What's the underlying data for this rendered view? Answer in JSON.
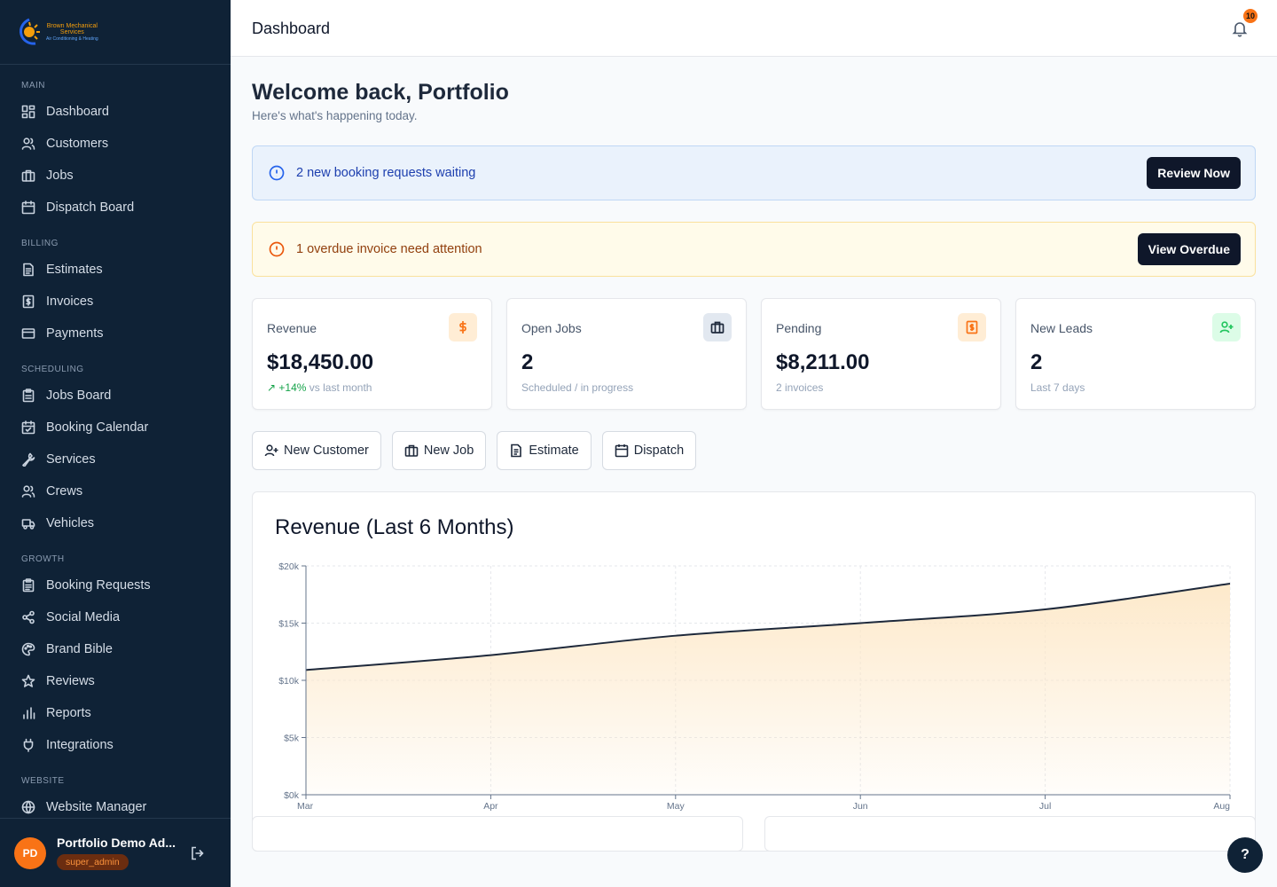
{
  "brand": {
    "line1": "Brown Mechanical",
    "line2": "Services",
    "tagline": "Air Conditioning & Heating"
  },
  "sidebar": {
    "sections": [
      {
        "title": "MAIN",
        "items": [
          {
            "label": "Dashboard",
            "icon": "dashboard-icon"
          },
          {
            "label": "Customers",
            "icon": "users-icon"
          },
          {
            "label": "Jobs",
            "icon": "briefcase-icon"
          },
          {
            "label": "Dispatch Board",
            "icon": "calendar-icon"
          }
        ]
      },
      {
        "title": "BILLING",
        "items": [
          {
            "label": "Estimates",
            "icon": "file-text-icon"
          },
          {
            "label": "Invoices",
            "icon": "receipt-icon"
          },
          {
            "label": "Payments",
            "icon": "credit-card-icon"
          }
        ]
      },
      {
        "title": "SCHEDULING",
        "items": [
          {
            "label": "Jobs Board",
            "icon": "clipboard-icon"
          },
          {
            "label": "Booking Calendar",
            "icon": "calendar-check-icon"
          },
          {
            "label": "Services",
            "icon": "wrench-icon"
          },
          {
            "label": "Crews",
            "icon": "users-icon"
          },
          {
            "label": "Vehicles",
            "icon": "truck-icon"
          }
        ]
      },
      {
        "title": "GROWTH",
        "items": [
          {
            "label": "Booking Requests",
            "icon": "clipboard-list-icon"
          },
          {
            "label": "Social Media",
            "icon": "share-icon"
          },
          {
            "label": "Brand Bible",
            "icon": "palette-icon"
          },
          {
            "label": "Reviews",
            "icon": "star-icon"
          },
          {
            "label": "Reports",
            "icon": "bar-chart-icon"
          },
          {
            "label": "Integrations",
            "icon": "plug-icon"
          }
        ]
      },
      {
        "title": "WEBSITE",
        "items": [
          {
            "label": "Website Manager",
            "icon": "globe-icon"
          }
        ]
      }
    ]
  },
  "user": {
    "initials": "PD",
    "name": "Portfolio Demo Ad...",
    "role": "super_admin"
  },
  "header": {
    "title": "Dashboard",
    "notification_count": "10"
  },
  "welcome": {
    "title": "Welcome back, Portfolio",
    "subtitle": "Here's what's happening today."
  },
  "alerts": {
    "booking": {
      "text": "2 new booking requests waiting",
      "button": "Review Now"
    },
    "overdue": {
      "text": "1 overdue invoice need attention",
      "button": "View Overdue"
    }
  },
  "stats": [
    {
      "label": "Revenue",
      "value": "$18,450.00",
      "trend": "+14%",
      "sub": "vs last month",
      "icon": "dollar-icon",
      "accent": "#f97316"
    },
    {
      "label": "Open Jobs",
      "value": "2",
      "sub": "Scheduled / in progress",
      "icon": "briefcase-icon",
      "accent": "#1e293b"
    },
    {
      "label": "Pending",
      "value": "$8,211.00",
      "sub": "2 invoices",
      "icon": "receipt-icon",
      "accent": "#f97316"
    },
    {
      "label": "New Leads",
      "value": "2",
      "sub": "Last 7 days",
      "icon": "user-plus-icon",
      "accent": "#22c55e"
    }
  ],
  "quick_actions": [
    {
      "label": "New Customer",
      "icon": "user-plus-icon"
    },
    {
      "label": "New Job",
      "icon": "briefcase-icon"
    },
    {
      "label": "Estimate",
      "icon": "file-text-icon"
    },
    {
      "label": "Dispatch",
      "icon": "calendar-icon"
    }
  ],
  "chart": {
    "title": "Revenue (Last 6 Months)"
  },
  "chart_data": {
    "type": "area",
    "title": "Revenue (Last 6 Months)",
    "categories": [
      "Mar",
      "Apr",
      "May",
      "Jun",
      "Jul",
      "Aug"
    ],
    "values": [
      10900,
      12200,
      13900,
      15000,
      16200,
      18450
    ],
    "y_ticks": [
      "$0k",
      "$5k",
      "$10k",
      "$15k",
      "$20k"
    ],
    "ylim": [
      0,
      20000
    ],
    "grid": true,
    "line_color": "#1e293b",
    "fill_color": "#fde8c8"
  },
  "help": {
    "label": "?"
  }
}
